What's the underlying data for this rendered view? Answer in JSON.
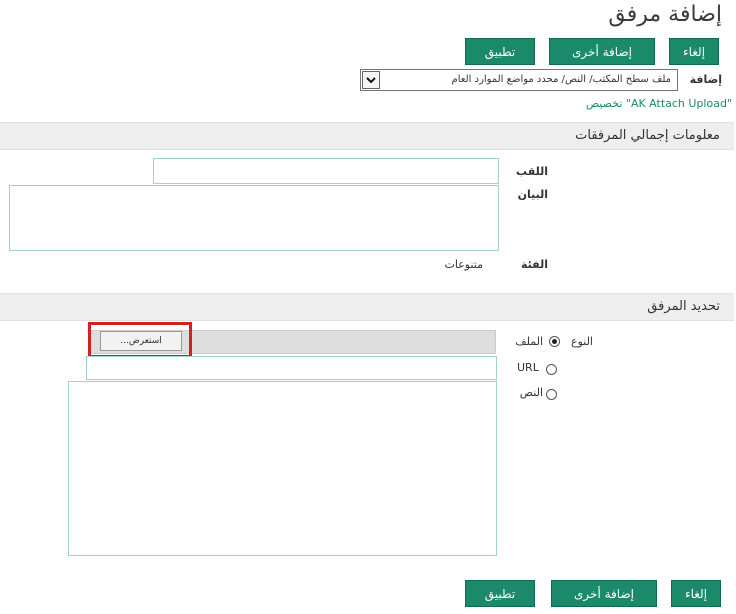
{
  "page": {
    "title": "إضافة مرفق"
  },
  "toolbar": {
    "cancel_label": "إلغاء",
    "add_another_label": "إضافة أخرى",
    "apply_label": "تطبيق"
  },
  "add_row": {
    "label": "إضافة",
    "select_value": "ملف سطح المكتب/ النص/ محدد مواضع الموارد العام"
  },
  "customize_link": "تخصيص \"AK Attach Upload\"",
  "summary_section": {
    "heading": "معلومات إجمالي المرفقات",
    "title_label": "اللقب",
    "title_value": "",
    "description_label": "البيان",
    "description_value": "",
    "category_label": "الفئة",
    "category_value": "متنوعات"
  },
  "attachment_section": {
    "heading": "تحديد المرفق",
    "type_label": "النوع",
    "browse_label": "...استعرض",
    "url_value": "",
    "text_value": "",
    "options": [
      {
        "label": "الملف",
        "selected": true
      },
      {
        "label": "URL",
        "selected": false
      },
      {
        "label": "النص",
        "selected": false
      }
    ]
  },
  "colors": {
    "button": "#1b8a6b",
    "highlight": "#d32020",
    "field_border": "#9fd3cc"
  }
}
